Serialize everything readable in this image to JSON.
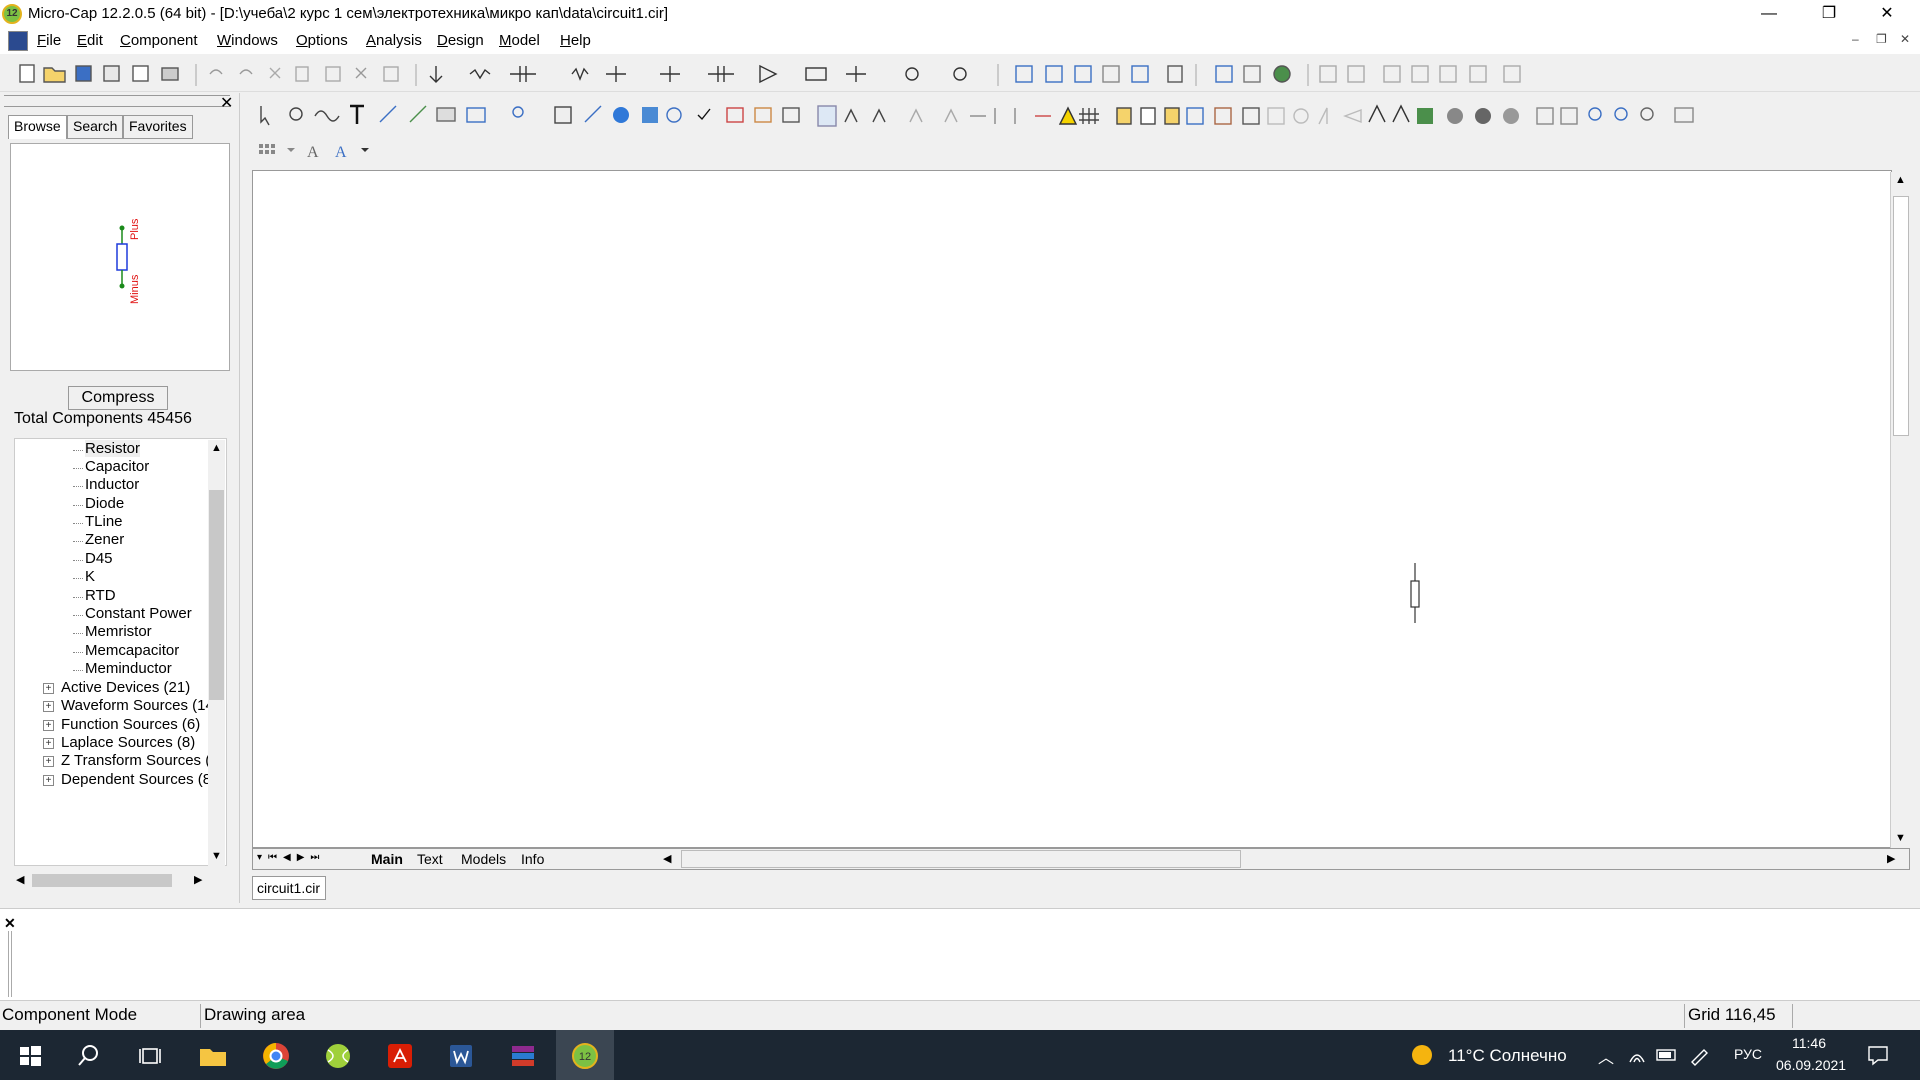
{
  "window": {
    "title": "Micro-Cap 12.2.0.5 (64 bit) - [D:\\учеба\\2 курс 1 сем\\электротехника\\микро кап\\data\\circuit1.cir]",
    "app_icon_text": "12",
    "minimize": "—",
    "restore": "❐",
    "close": "✕"
  },
  "menubar": {
    "items": [
      "File",
      "Edit",
      "Component",
      "Windows",
      "Options",
      "Analysis",
      "Design",
      "Model",
      "Help"
    ]
  },
  "left_panel": {
    "tabs": [
      "Browse",
      "Search",
      "Favorites"
    ],
    "preview": {
      "label_top": "Plus",
      "label_bottom": "Minus"
    },
    "compress_label": "Compress",
    "total_components": "Total Components 45456",
    "tree_leaves": [
      "Resistor",
      "Capacitor",
      "Inductor",
      "Diode",
      "TLine",
      "Zener",
      "D45",
      "K",
      "RTD",
      "Constant Power",
      "Memristor",
      "Memcapacitor",
      "Meminductor"
    ],
    "tree_groups": [
      "Active Devices (21)",
      "Waveform Sources (14",
      "Function Sources (6)",
      "Laplace Sources (8)",
      "Z Transform Sources (",
      "Dependent Sources (8"
    ]
  },
  "editor": {
    "bottom_tabs": [
      "Main",
      "Text",
      "Models",
      "Info"
    ],
    "file_tab": "circuit1.cir"
  },
  "statusbar": {
    "mode": "Component Mode",
    "hint": "Drawing area",
    "grid": "Grid 116,45"
  },
  "taskbar": {
    "weather": "11°C  Солнечно",
    "language": "РУС",
    "time": "11:46",
    "date": "06.09.2021"
  },
  "colors": {
    "pin_label": "#e01010",
    "pin_dot": "#1a8a1a",
    "body_outline": "#1f3bdc",
    "taskbar_bg": "#1c2733"
  }
}
